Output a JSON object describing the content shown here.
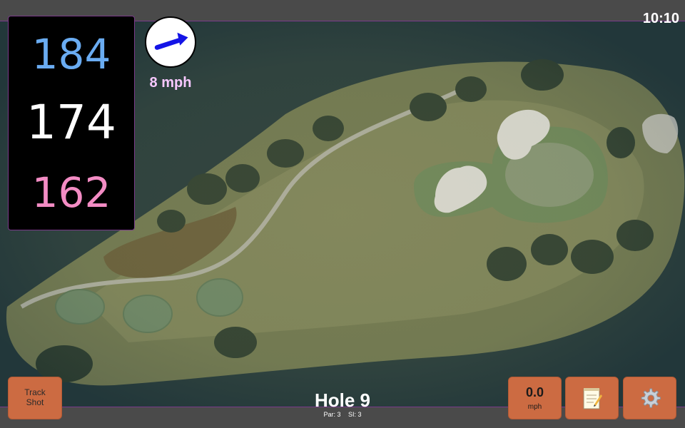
{
  "status": {
    "clock": "10:10"
  },
  "distances": {
    "back": "184",
    "middle": "174",
    "front": "162"
  },
  "wind": {
    "speed_label": "8 mph",
    "direction_icon": "arrow-icon"
  },
  "hole": {
    "title": "Hole 9",
    "par_label": "Par: 3",
    "si_label": "SI: 3"
  },
  "buttons": {
    "track_shot_line1": "Track",
    "track_shot_line2": "Shot",
    "speed_value": "0.0",
    "speed_unit": "mph",
    "notes_icon": "notepad-icon",
    "settings_icon": "gear-icon"
  },
  "colors": {
    "panel_bg": "#000000",
    "back_distance": "#6aacf2",
    "middle_distance": "#ffffff",
    "front_distance": "#f38cc4",
    "wind_text": "#f7c8ff",
    "button_bg": "#cc6b42",
    "accent_border": "#7a3a8a"
  }
}
